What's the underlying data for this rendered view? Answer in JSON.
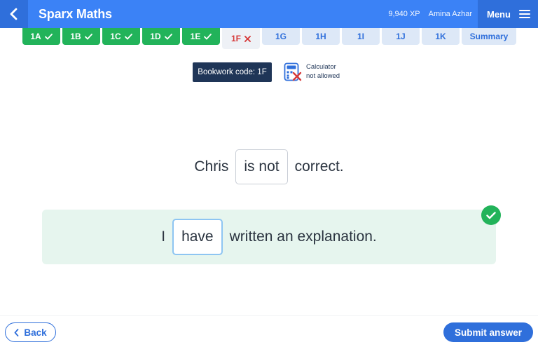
{
  "header": {
    "app_title": "Sparx Maths",
    "xp": "9,940 XP",
    "user_name": "Amina Azhar",
    "menu_label": "Menu"
  },
  "tabs": [
    {
      "label": "1A",
      "status": "done"
    },
    {
      "label": "1B",
      "status": "done"
    },
    {
      "label": "1C",
      "status": "done"
    },
    {
      "label": "1D",
      "status": "done"
    },
    {
      "label": "1E",
      "status": "done"
    },
    {
      "label": "1F",
      "status": "current"
    },
    {
      "label": "1G",
      "status": "todo"
    },
    {
      "label": "1H",
      "status": "todo"
    },
    {
      "label": "1I",
      "status": "todo"
    },
    {
      "label": "1J",
      "status": "todo"
    },
    {
      "label": "1K",
      "status": "todo"
    },
    {
      "label": "Summary",
      "status": "todo"
    }
  ],
  "bookwork": {
    "label": "Bookwork code: 1F"
  },
  "calculator": {
    "line1": "Calculator",
    "line2": "not allowed",
    "icon": "calculator-icon"
  },
  "question1": {
    "before": "Chris",
    "answer": "is not",
    "after": "correct."
  },
  "question2": {
    "before": "I",
    "answer": "have",
    "after": "written an explanation."
  },
  "footer": {
    "back_label": "Back",
    "submit_label": "Submit answer"
  },
  "colors": {
    "primary": "#3b82f6",
    "done": "#22b35a",
    "wrong": "#d63a3a",
    "navy": "#1f3557"
  }
}
